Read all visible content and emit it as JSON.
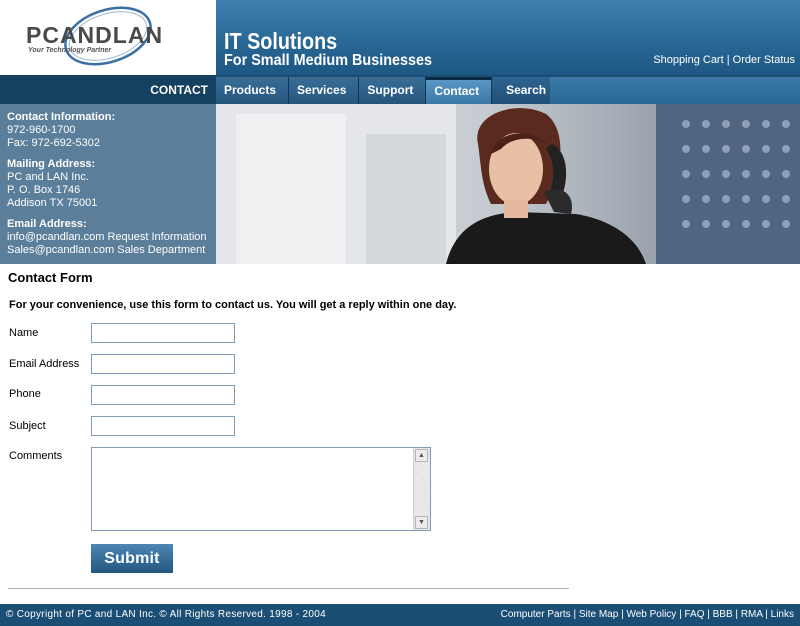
{
  "logo": {
    "name": "PCANDLAN",
    "tagline": "Your Technology Partner"
  },
  "banner": {
    "title": "IT Solutions",
    "subtitle": "For Small Medium Businesses",
    "links": [
      "Shopping Cart",
      "Order Status"
    ]
  },
  "nav": {
    "section_label": "CONTACT",
    "tabs": [
      "Products",
      "Services",
      "Support",
      "Contact",
      "Search"
    ]
  },
  "contact_info": {
    "heading": "Contact Information:",
    "phone": "972-960-1700",
    "fax": "Fax: 972-692-5302",
    "mailing_heading": "Mailing Address:",
    "mailing_line1": "PC and LAN Inc.",
    "mailing_line2": "P. O. Box 1746",
    "mailing_line3": "Addison TX 75001",
    "email_heading": "Email Address:",
    "email_line1": "info@pcandlan.com Request Information",
    "email_line2": "Sales@pcandlan.com  Sales Department"
  },
  "form": {
    "title": "Contact Form",
    "intro": "For your convenience, use this form to contact us.  You will get a reply within one day.",
    "fields": {
      "name_label": "Name",
      "email_label": "Email Address",
      "phone_label": "Phone",
      "subject_label": "Subject",
      "comments_label": "Comments"
    },
    "values": {
      "name": "",
      "email": "",
      "phone": "",
      "subject": ""
    },
    "submit_label": "Submit"
  },
  "footer": {
    "copyright_symbol": "©",
    "copyright": "Copyright of PC and LAN Inc. © All Rights Reserved. 1998 - 2004",
    "links": [
      "Computer Parts",
      "Site Map",
      "Web Policy",
      "FAQ",
      "BBB",
      "RMA",
      "Links"
    ]
  },
  "colors": {
    "navy": "#1b4e75",
    "banner_blue": "#2a6896",
    "info_panel": "#5b7e9b"
  }
}
